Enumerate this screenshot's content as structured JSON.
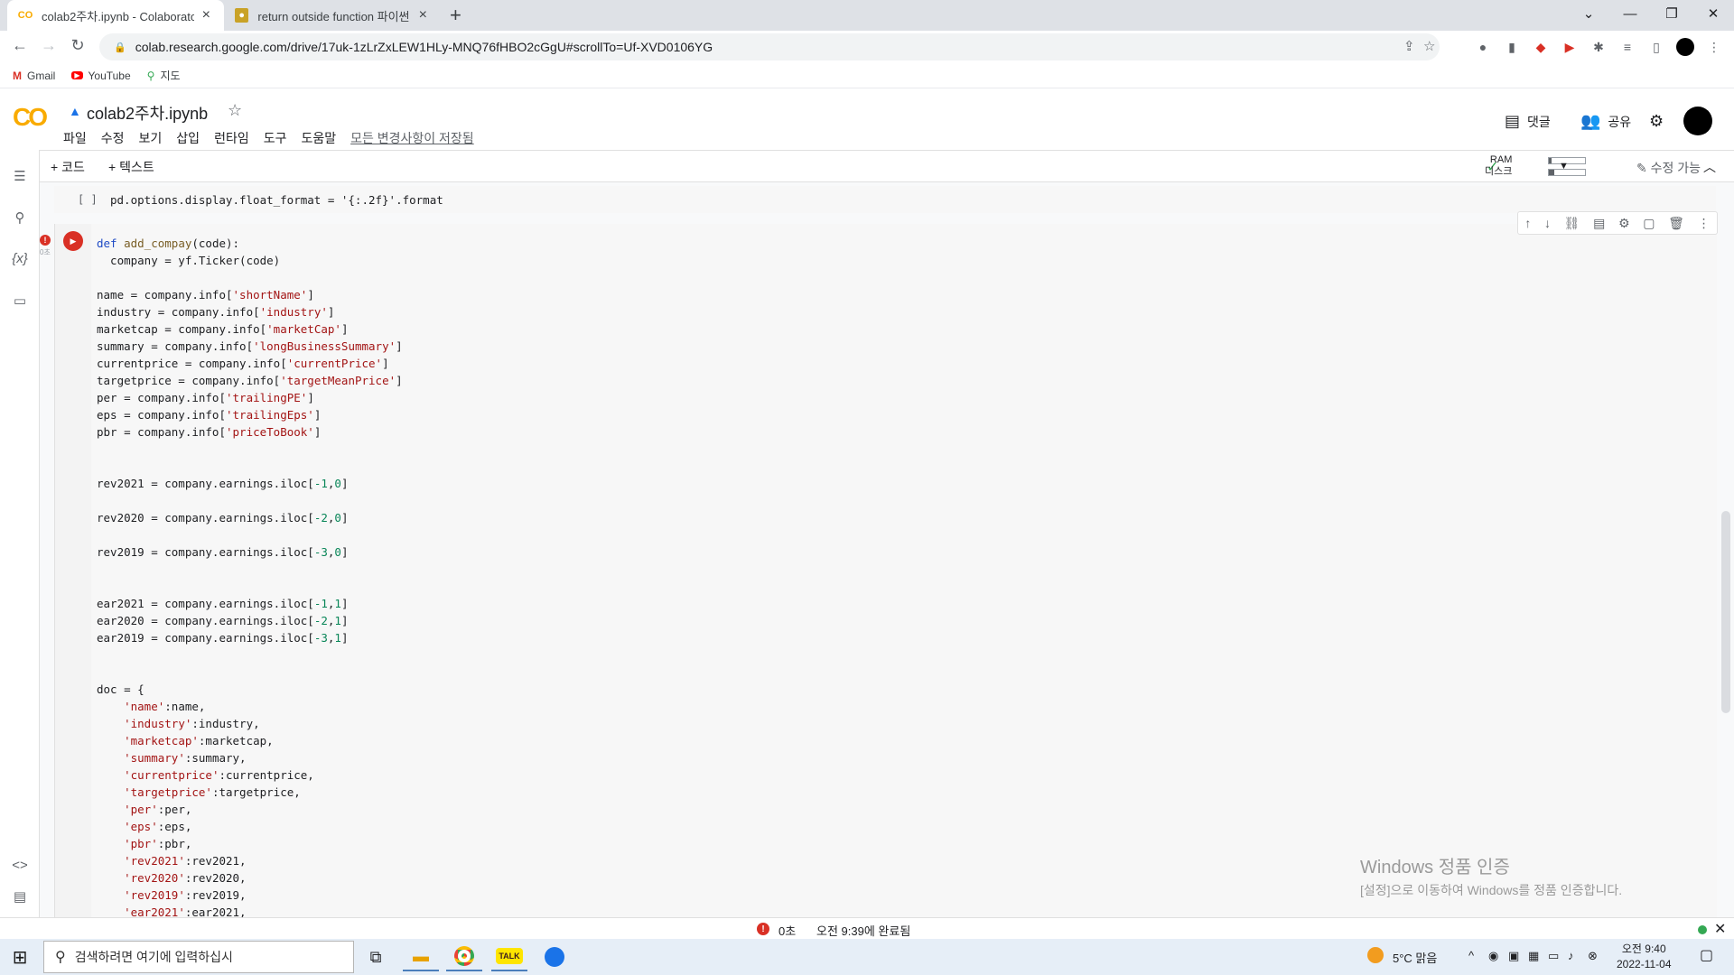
{
  "browser": {
    "tabs": [
      {
        "title": "colab2주차.ipynb - Colaboratory",
        "favicon": "colab-icon",
        "active": true
      },
      {
        "title": "return outside function 파이썬",
        "favicon": "page-icon",
        "active": false
      }
    ],
    "url": "colab.research.google.com/drive/17uk-1zLrZxLEW1HLy-MNQ76fHBO2cGgU#scrollTo=Uf-XVD0106YG",
    "bookmarks": [
      {
        "label": "Gmail",
        "icon": "gmail-icon"
      },
      {
        "label": "YouTube",
        "icon": "youtube-icon"
      },
      {
        "label": "지도",
        "icon": "maps-icon"
      }
    ]
  },
  "colab": {
    "logo": "CO",
    "notebook_title": "colab2주차.ipynb",
    "menu": [
      "파일",
      "수정",
      "보기",
      "삽입",
      "런타임",
      "도구",
      "도움말"
    ],
    "save_status": "모든 변경사항이 저장됨",
    "comments_label": "댓글",
    "share_label": "공유",
    "add_code": "+ 코드",
    "add_text": "+ 텍스트",
    "ram_label": "RAM",
    "disk_label": "디스크",
    "edit_mode": "수정 가능"
  },
  "cells": {
    "cell1_prompt": "[ ]",
    "cell1_code": "pd.options.display.float_format = '{:.2f}'.format",
    "cell2_time": "0초"
  },
  "status": {
    "error_count": "0초",
    "completed": "오전 9:39에 완료됨"
  },
  "watermark": {
    "title": "Windows 정품 인증",
    "subtitle": "[설정]으로 이동하여 Windows를 정품 인증합니다."
  },
  "taskbar": {
    "search_placeholder": "검색하려면 여기에 입력하십시",
    "weather": "5°C  맑음",
    "time": "오전 9:40",
    "date": "2022-11-04"
  },
  "colors": {
    "accent_orange": "#f9ab00",
    "error_red": "#d93025",
    "ok_green": "#34a853"
  }
}
